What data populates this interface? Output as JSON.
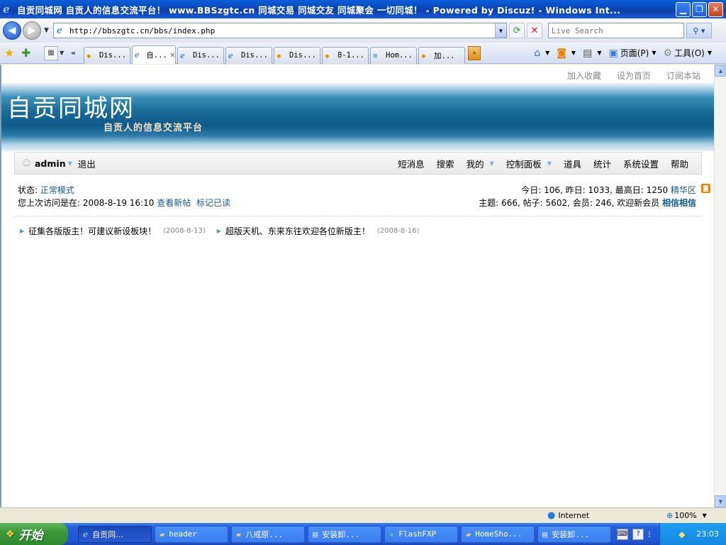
{
  "window": {
    "title": "自贡同城网 自贡人的信息交流平台！ www.BBSzgtc.cn 同城交易 同城交友 同城聚会 一切同城！ - Powered by Discuz! - Windows Int...",
    "minimize_glyph": "▁",
    "restore_glyph": "❐",
    "close_glyph": "✕"
  },
  "browser": {
    "url": "http://bbszgtc.cn/bbs/index.php",
    "search_placeholder": "Live Search",
    "tabs": [
      {
        "label": "Dis...",
        "icon": "shield-icon",
        "active": false
      },
      {
        "label": "自...",
        "icon": "ie-icon",
        "active": true
      },
      {
        "label": "Dis...",
        "icon": "ie-icon",
        "active": false
      },
      {
        "label": "Dis...",
        "icon": "ie-icon",
        "active": false
      },
      {
        "label": "Dis...",
        "icon": "shield-icon",
        "active": false
      },
      {
        "label": "8-1...",
        "icon": "shield-icon",
        "active": false
      },
      {
        "label": "Hom...",
        "icon": "web-icon",
        "active": false
      },
      {
        "label": "加...",
        "icon": "shield-icon",
        "active": false
      }
    ],
    "commands": {
      "page": "页面(P)",
      "tools": "工具(O)"
    },
    "statusbar": {
      "zone": "Internet",
      "zoom": "100%"
    }
  },
  "page": {
    "toplinks": [
      "加入收藏",
      "设为首页",
      "订阅本站"
    ],
    "site_name": "自贡同城网",
    "site_slogan": "自贡人的信息交流平台",
    "user": {
      "name": "admin",
      "logout": "退出"
    },
    "menu": [
      "短消息",
      "搜索",
      "我的",
      "控制面板",
      "道具",
      "统计",
      "系统设置",
      "帮助"
    ],
    "status": {
      "mode_label": "状态:",
      "mode_value": "正常模式",
      "last_visit_label": "您上次访问是在:",
      "last_visit_time": "2008-8-19 16:10",
      "new_posts": "查看新帖",
      "mark_read": "标记已读"
    },
    "stats": {
      "today_label": "今日:",
      "today": "106",
      "yesterday_label": ", 昨日:",
      "yesterday": "1033",
      "max_label": ", 最高日:",
      "max": "1250",
      "digest": "精华区",
      "topics_label": "主题:",
      "topics": "666",
      "posts_label": ", 帖子:",
      "posts": "5602",
      "members_label": ", 会员:",
      "members": "246",
      "welcome_label": ", 欢迎新会员",
      "newest_member": "相信相信"
    },
    "announcements": [
      {
        "title": "征集各版版主！可建议新设板块！",
        "date": "(2008-8-13)"
      },
      {
        "title": "超版天机、东来东往欢迎各位新版主！",
        "date": "(2008-8-16)"
      }
    ]
  },
  "taskbar": {
    "start": "开始",
    "tasks": [
      {
        "label": "自贡同...",
        "icon": "ie-icon",
        "active": true
      },
      {
        "label": "header",
        "icon": "folder-icon",
        "active": false
      },
      {
        "label": "八戒原...",
        "icon": "folder-icon",
        "active": false
      },
      {
        "label": "安装卸...",
        "icon": "doc-icon",
        "active": false
      },
      {
        "label": "FlashFXP",
        "icon": "ftp-icon",
        "active": false
      },
      {
        "label": "HomeSho...",
        "icon": "folder-icon",
        "active": false
      },
      {
        "label": "安装卸...",
        "icon": "doc-icon",
        "active": false
      }
    ],
    "clock": "23:03"
  }
}
